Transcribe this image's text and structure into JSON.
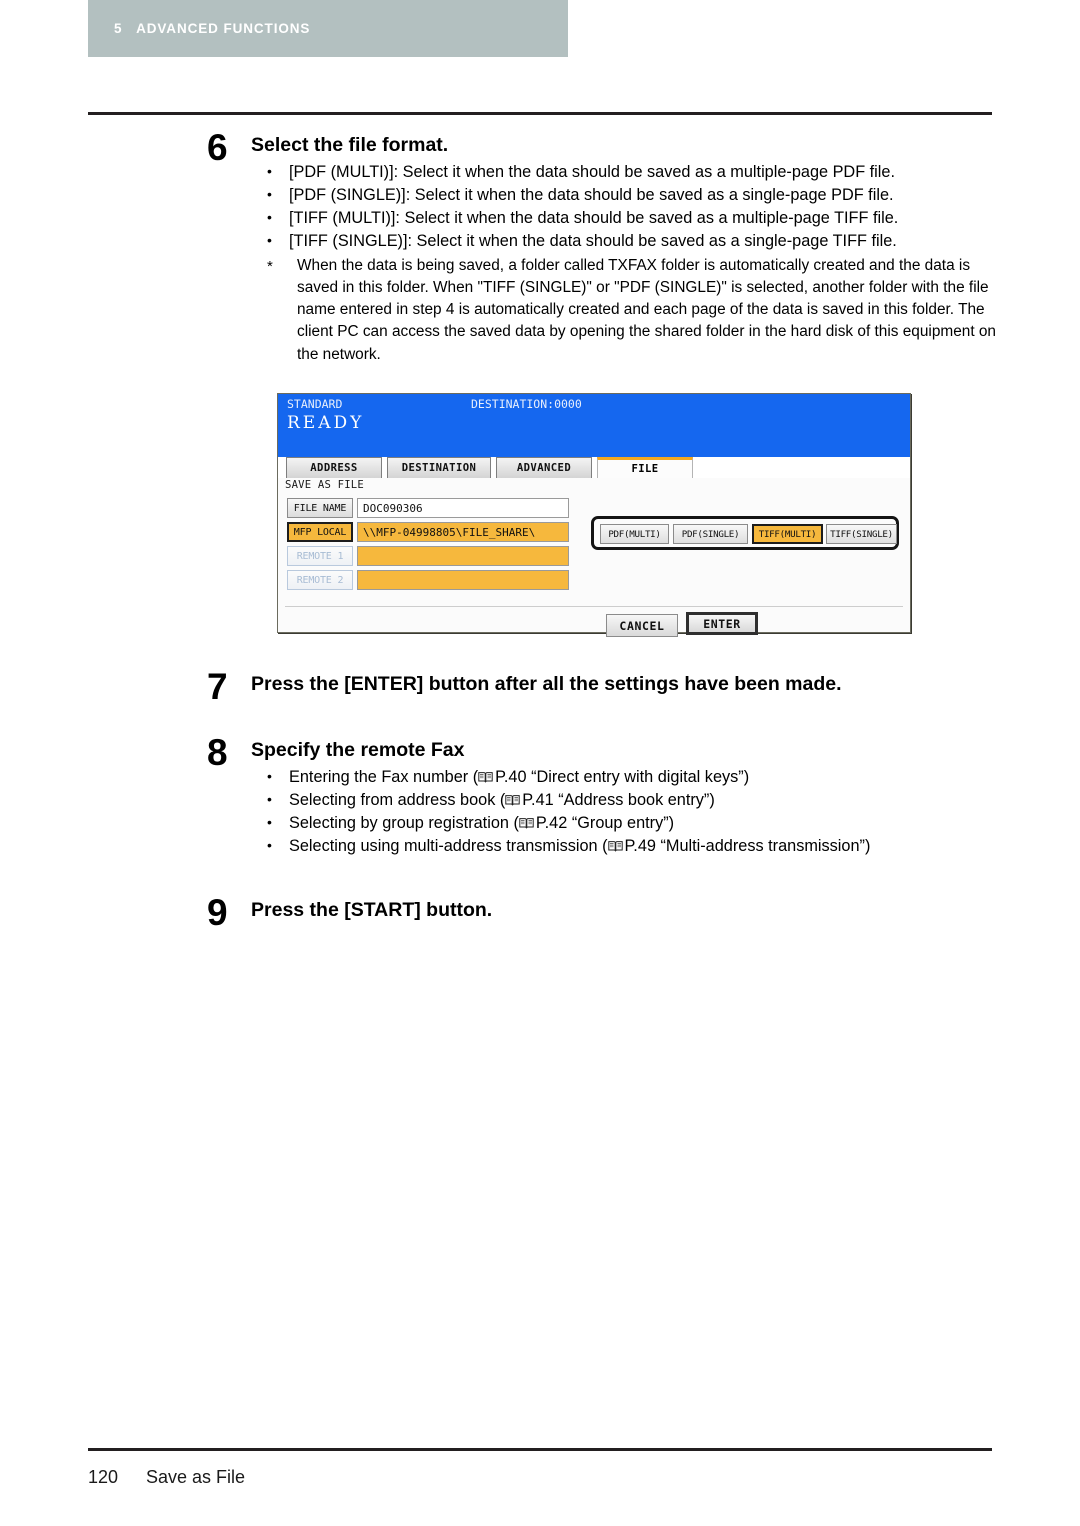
{
  "running_head": {
    "chapter_number": "5",
    "chapter_title": "ADVANCED FUNCTIONS"
  },
  "steps": [
    {
      "number": "6",
      "title": "Select the file format.",
      "bullets": [
        "[PDF (MULTI)]: Select it when the data should be saved as a multiple-page PDF file.",
        "[PDF (SINGLE)]: Select it when the data should be saved as a single-page PDF file.",
        "[TIFF (MULTI)]: Select it when the data should be saved as a multiple-page TIFF file.",
        "[TIFF (SINGLE)]: Select it when the data should be saved as a single-page TIFF file."
      ],
      "note_marker": "*",
      "note": "When the data is being saved, a folder called TXFAX folder is automatically created and the data is saved in this folder. When \"TIFF (SINGLE)\" or  \"PDF (SINGLE)\" is selected, another folder with the file name entered in step 4 is automatically created and each page of the data is saved in this folder. The client PC can access the saved data by opening the shared folder in the hard disk of this equipment on the network."
    },
    {
      "number": "7",
      "title": "Press the [ENTER] button after all the settings have been made."
    },
    {
      "number": "8",
      "title": "Specify the remote Fax",
      "refs": [
        {
          "text_before": "Entering the Fax number (",
          "page": "P.40",
          "quote": "“Direct entry with digital keys”",
          "text_after": ")"
        },
        {
          "text_before": "Selecting from address book (",
          "page": "P.41",
          "quote": "“Address book entry”",
          "text_after": ")"
        },
        {
          "text_before": "Selecting by group registration (",
          "page": "P.42",
          "quote": "“Group entry”",
          "text_after": ")"
        },
        {
          "text_before": "Selecting using multi-address transmission (",
          "page": "P.49",
          "quote": "“Multi-address transmission”",
          "text_after": ")"
        }
      ]
    },
    {
      "number": "9",
      "title": "Press the [START] button."
    }
  ],
  "device_screen": {
    "status_left": "STANDARD",
    "destination": "DESTINATION:0000",
    "ready": "READY",
    "tabs": [
      {
        "label": "ADDRESS",
        "active": false
      },
      {
        "label": "DESTINATION",
        "active": false
      },
      {
        "label": "ADVANCED",
        "active": false
      },
      {
        "label": "FILE",
        "active": true
      }
    ],
    "panel_title": "SAVE AS FILE",
    "rows": [
      {
        "button": "FILE NAME",
        "value": "DOC090306",
        "amber": false,
        "selected": false,
        "dim": false
      },
      {
        "button": "MFP LOCAL",
        "value": "\\\\MFP-04998805\\FILE_SHARE\\",
        "amber": true,
        "selected": true,
        "dim": false
      },
      {
        "button": "REMOTE 1",
        "value": "",
        "amber": true,
        "selected": false,
        "dim": true
      },
      {
        "button": "REMOTE 2",
        "value": "",
        "amber": true,
        "selected": false,
        "dim": true
      }
    ],
    "formats": [
      {
        "label": "PDF(MULTI)",
        "selected": false
      },
      {
        "label": "PDF(SINGLE)",
        "selected": false
      },
      {
        "label": "TIFF(MULTI)",
        "selected": true
      },
      {
        "label": "TIFF(SINGLE)",
        "selected": false
      }
    ],
    "cancel_label": "CANCEL",
    "enter_label": "ENTER",
    "accent_color": "#f6b83d",
    "header_color": "#1567ef"
  },
  "footer": {
    "page_number": "120",
    "section": "Save as File"
  }
}
